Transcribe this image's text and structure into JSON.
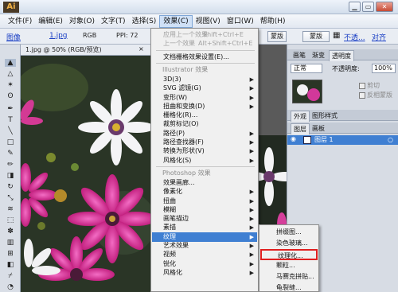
{
  "app": {
    "logo": "Ai",
    "window_buttons": {
      "help": "?",
      "restore": "▭",
      "close": "✕"
    }
  },
  "menubar": [
    {
      "label": "文件(F)"
    },
    {
      "label": "编辑(E)"
    },
    {
      "label": "对象(O)"
    },
    {
      "label": "文字(T)"
    },
    {
      "label": "选择(S)"
    },
    {
      "label": "效果(C)",
      "active": true
    },
    {
      "label": "视图(V)"
    },
    {
      "label": "窗口(W)"
    },
    {
      "label": "帮助(H)"
    }
  ],
  "controlbar": {
    "image_link": "图像",
    "filename_link": "1.jpg",
    "color_mode": "RGB",
    "ppi": "PPI: 72",
    "mask_label": "蒙版",
    "no_transparency_link": "不透...",
    "align_link": "对齐"
  },
  "document_tab": {
    "title": "1.jpg @ 50% (RGB/预览)",
    "close": "×"
  },
  "effect_menu": {
    "items": [
      {
        "label": "应用上一个效果",
        "shortcut": "Shift+Ctrl+E",
        "disabled": true
      },
      {
        "label": "上一个效果",
        "shortcut": "Alt+Shift+Ctrl+E",
        "disabled": true
      },
      {
        "separator": true
      },
      {
        "label": "文档栅格效果设置(E)..."
      },
      {
        "separator": true
      },
      {
        "header": "Illustrator 效果"
      },
      {
        "label": "3D(3)",
        "submenu": true
      },
      {
        "label": "SVG 滤镜(G)",
        "submenu": true
      },
      {
        "label": "变形(W)",
        "submenu": true
      },
      {
        "label": "扭曲和变换(D)",
        "submenu": true
      },
      {
        "label": "栅格化(R)..."
      },
      {
        "label": "裁剪标记(O)"
      },
      {
        "label": "路径(P)",
        "submenu": true
      },
      {
        "label": "路径查找器(F)",
        "submenu": true
      },
      {
        "label": "转换为形状(V)",
        "submenu": true
      },
      {
        "label": "风格化(S)",
        "submenu": true
      },
      {
        "separator": true
      },
      {
        "header": "Photoshop 效果"
      },
      {
        "label": "效果画廊..."
      },
      {
        "label": "像素化",
        "submenu": true
      },
      {
        "label": "扭曲",
        "submenu": true
      },
      {
        "label": "模糊",
        "submenu": true
      },
      {
        "label": "画笔描边",
        "submenu": true
      },
      {
        "label": "素描",
        "submenu": true
      },
      {
        "label": "纹理",
        "submenu": true,
        "highlight": true
      },
      {
        "label": "艺术效果",
        "submenu": true
      },
      {
        "label": "视频",
        "submenu": true
      },
      {
        "label": "锐化",
        "submenu": true
      },
      {
        "label": "风格化",
        "submenu": true
      }
    ]
  },
  "texture_submenu": {
    "items": [
      {
        "label": "拼缀图..."
      },
      {
        "label": "染色玻璃..."
      },
      {
        "label": "纹理化...",
        "selected": true
      },
      {
        "label": "颗粒..."
      },
      {
        "label": "马赛克拼贴..."
      },
      {
        "label": "龟裂缝..."
      }
    ]
  },
  "right_panels": {
    "tabs_top": [
      "画笔",
      "渐变",
      "透明度"
    ],
    "blend_mode": "正常",
    "opacity_label": "不透明度:",
    "opacity_value": "100%",
    "clip_label": "剪切",
    "invert_mask_label": "反相蒙版",
    "tabs_mid": [
      "外观",
      "图形样式"
    ],
    "tabs_layers": [
      "图层",
      "画板"
    ],
    "layer_name": "图层 1"
  },
  "colors": {
    "highlight": "#3f7fd2",
    "selected_outline": "#e02020",
    "layer_highlight": "#3f7fd2",
    "link": "#1a3fc4"
  }
}
